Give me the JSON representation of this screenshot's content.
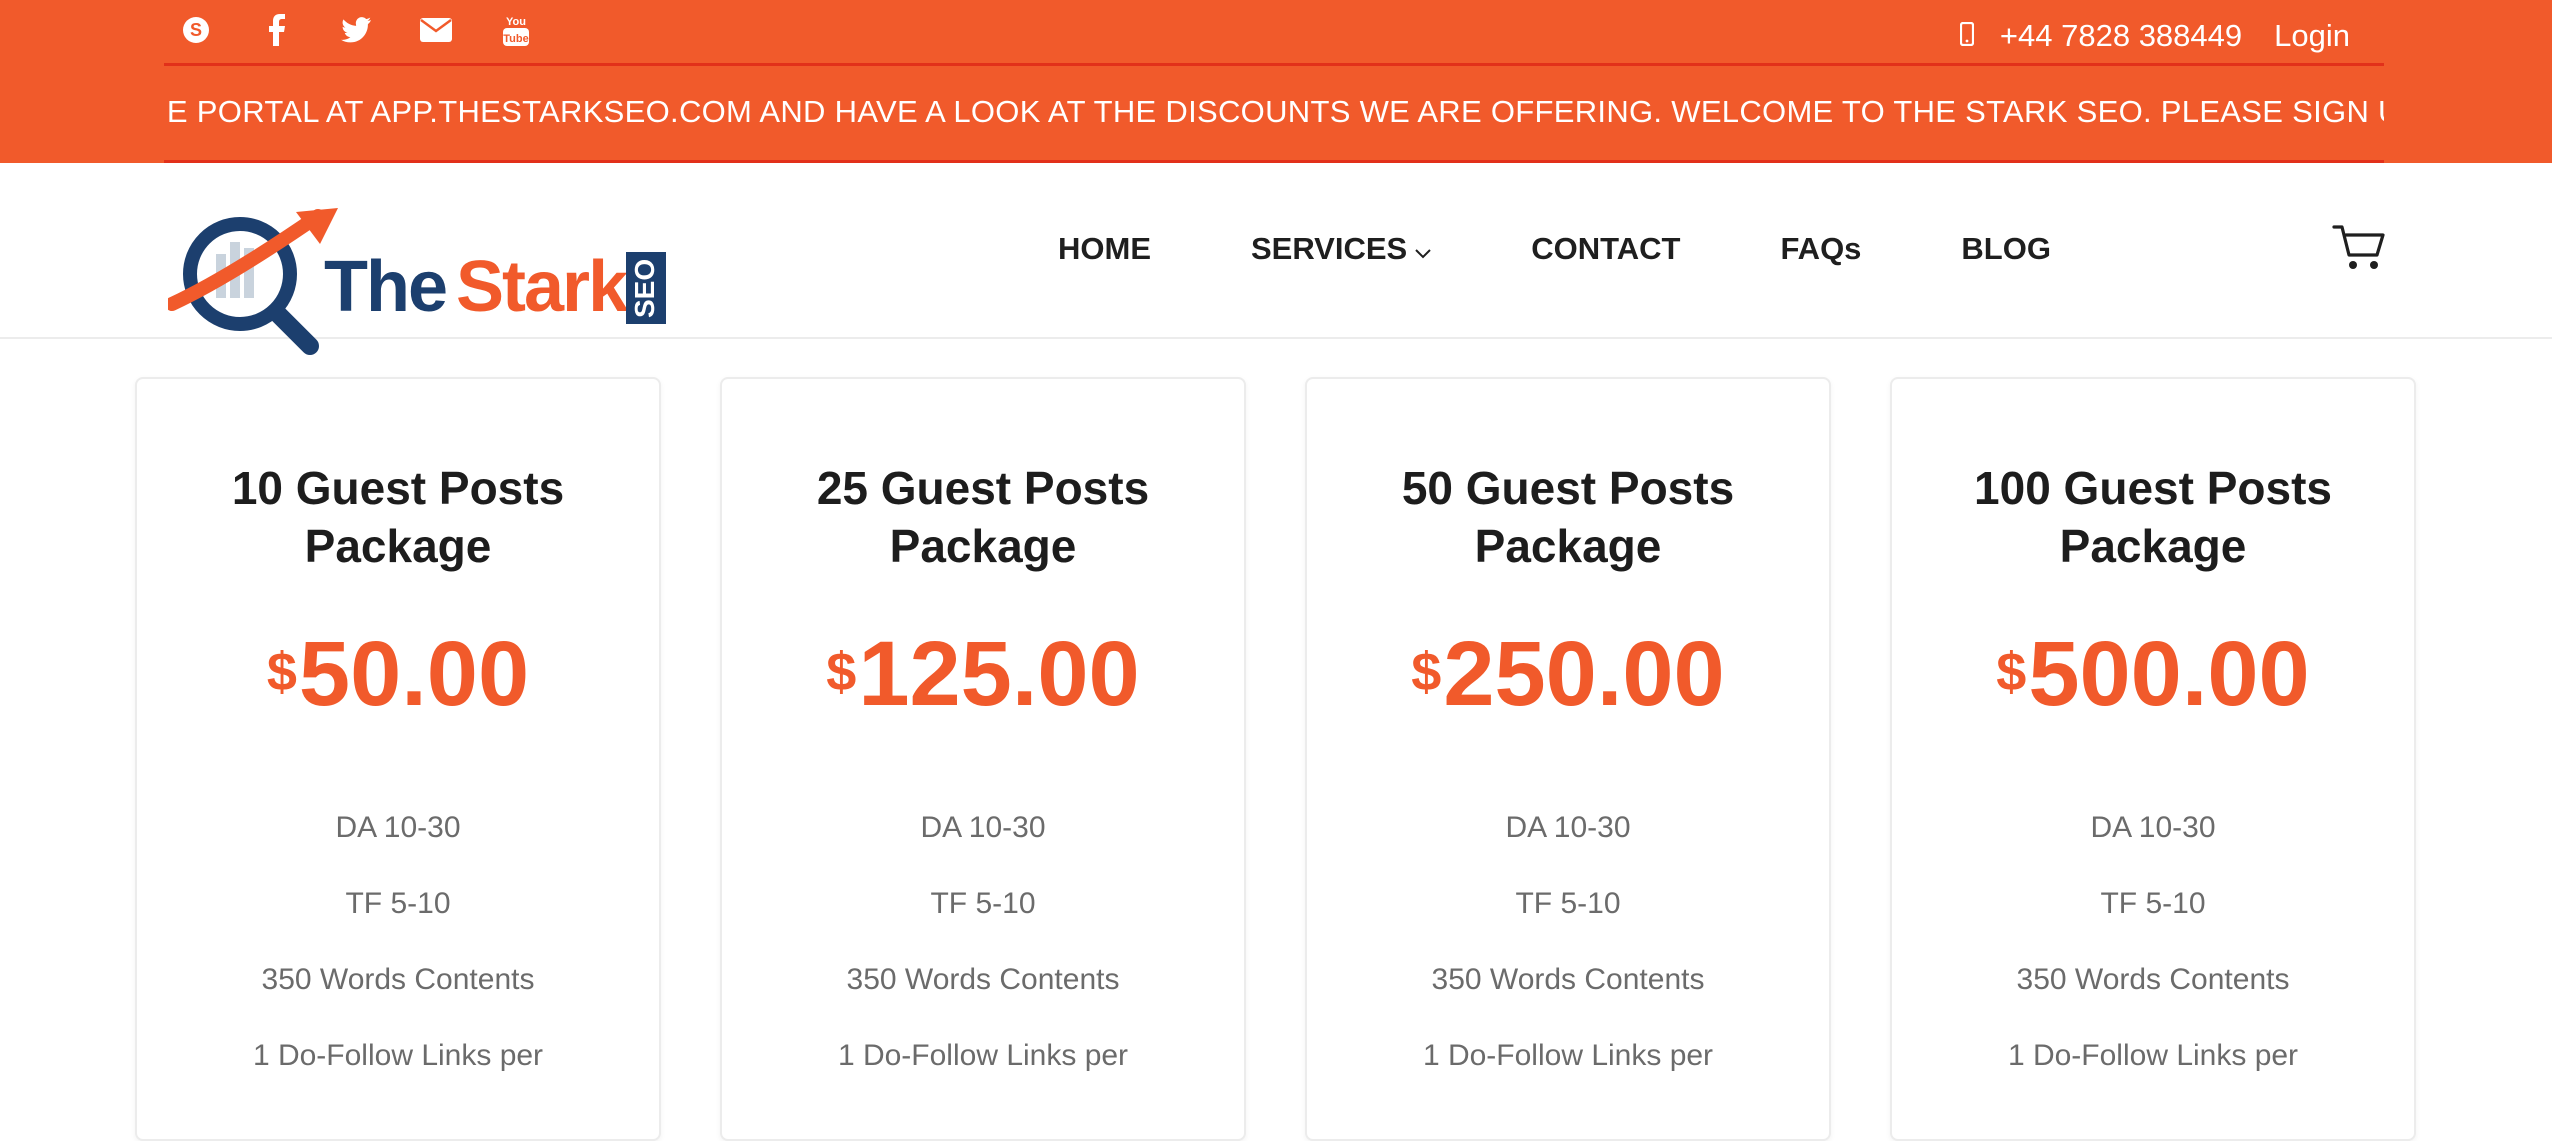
{
  "topbar": {
    "social": [
      "skype-icon",
      "facebook-icon",
      "twitter-icon",
      "envelope-icon",
      "youtube-icon"
    ],
    "phone": "+44 7828 388449",
    "login": "Login",
    "marquee": "IE PORTAL AT APP.THESTARKSEO.COM AND HAVE A LOOK AT THE DISCOUNTS WE ARE OFFERING.   WELCOME TO THE STARK SEO. PLEASE SIGN UP TO T"
  },
  "logo": {
    "word1": "The",
    "word2": "Stark",
    "badge": "SEO"
  },
  "nav": {
    "home": "HOME",
    "services": "SERVICES",
    "contact": "CONTACT",
    "faqs": "FAQs",
    "blog": "BLOG"
  },
  "cards": [
    {
      "title_line1": "10  Guest Posts",
      "title_line2": "Package",
      "currency": "$",
      "price": "50.00",
      "features": [
        "DA  10-30",
        "TF  5-10",
        "350  Words Contents",
        "1   Do-Follow Links per"
      ]
    },
    {
      "title_line1": "25  Guest Posts",
      "title_line2": "Package",
      "currency": "$",
      "price": "125.00",
      "features": [
        "DA  10-30",
        "TF  5-10",
        "350  Words Contents",
        "1  Do-Follow Links per"
      ]
    },
    {
      "title_line1": "50  Guest Posts",
      "title_line2": "Package",
      "currency": "$",
      "price": "250.00",
      "features": [
        "DA  10-30",
        "TF  5-10",
        "350  Words Contents",
        "1  Do-Follow Links per"
      ]
    },
    {
      "title_line1": "100  Guest Posts",
      "title_line2": "Package",
      "currency": "$",
      "price": "500.00",
      "features": [
        "DA  10-30",
        "TF  5-10",
        "350   Words Contents",
        "1   Do-Follow Links per"
      ]
    }
  ],
  "colors": {
    "brand_orange": "#f15a2b",
    "brand_navy": "#1c3f6e",
    "divider_red": "#e2301a"
  }
}
